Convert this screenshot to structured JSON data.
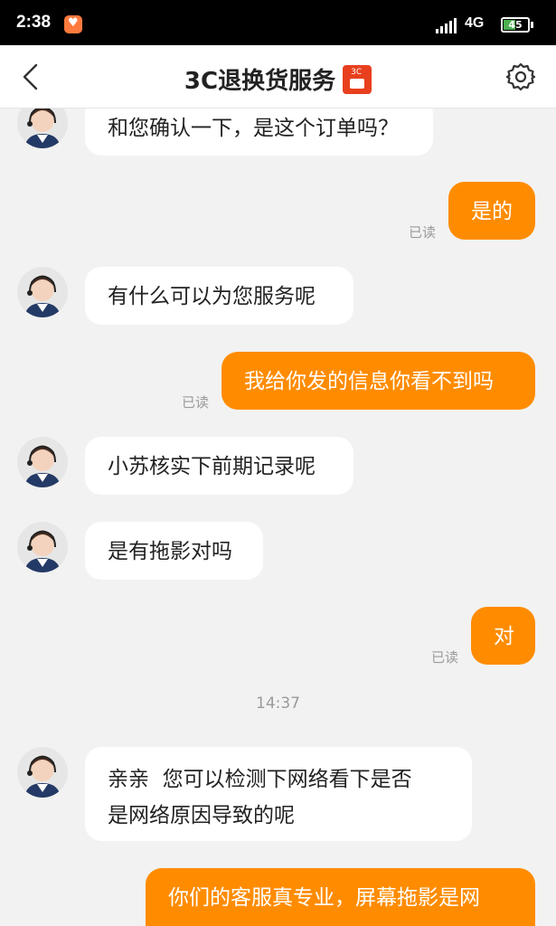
{
  "status_bar": {
    "time": "2:38",
    "network": "4G",
    "battery": "45"
  },
  "header": {
    "title": "3C退换货服务",
    "badge_icon": "3c-service-badge-icon"
  },
  "messages": [
    {
      "side": "left",
      "text": "和您确认一下，是这个订单吗？"
    },
    {
      "side": "right",
      "text": "是的",
      "read": "已读"
    },
    {
      "side": "left",
      "text": "有什么可以为您服务呢"
    },
    {
      "side": "right",
      "text": "我给你发的信息你看不到吗",
      "read": "已读"
    },
    {
      "side": "left",
      "text": "小苏核实下前期记录呢"
    },
    {
      "side": "left",
      "text": "是有拖影对吗"
    },
    {
      "side": "right",
      "text": "对",
      "read": "已读"
    },
    {
      "side": "left",
      "lines": [
        "亲亲  您可以检测下网络看下是否",
        "是网络原因导致的呢"
      ]
    },
    {
      "side": "right",
      "text": "你们的客服真专业，屏幕拖影是网"
    }
  ],
  "timestamp": "14:37",
  "colors": {
    "accent": "#ff8c00",
    "background": "#f2f2f2",
    "bubble_left": "#ffffff"
  }
}
